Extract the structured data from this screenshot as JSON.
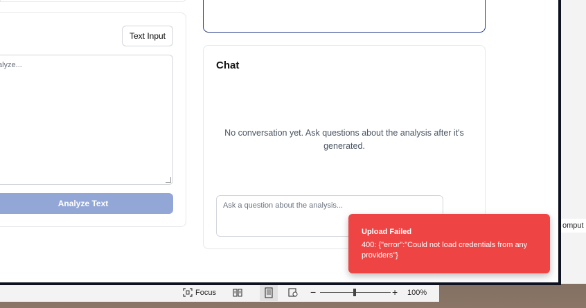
{
  "word": {
    "partial_text": "omput",
    "focus_label": "Focus",
    "zoom_minus": "−",
    "zoom_plus": "+",
    "zoom_percent": "100%"
  },
  "left_panel": {
    "mode_button": "Text Input",
    "textarea_placeholder": "alyze...",
    "analyze_button": "Analyze Text"
  },
  "chat": {
    "title": "Chat",
    "empty_message": "No conversation yet. Ask questions about the analysis after it's generated.",
    "input_placeholder": "Ask a question about the analysis..."
  },
  "toast": {
    "title": "Upload Failed",
    "message": "400: {\"error\":\"Could not load credentials from any providers\"}",
    "color": "#ef4444"
  }
}
